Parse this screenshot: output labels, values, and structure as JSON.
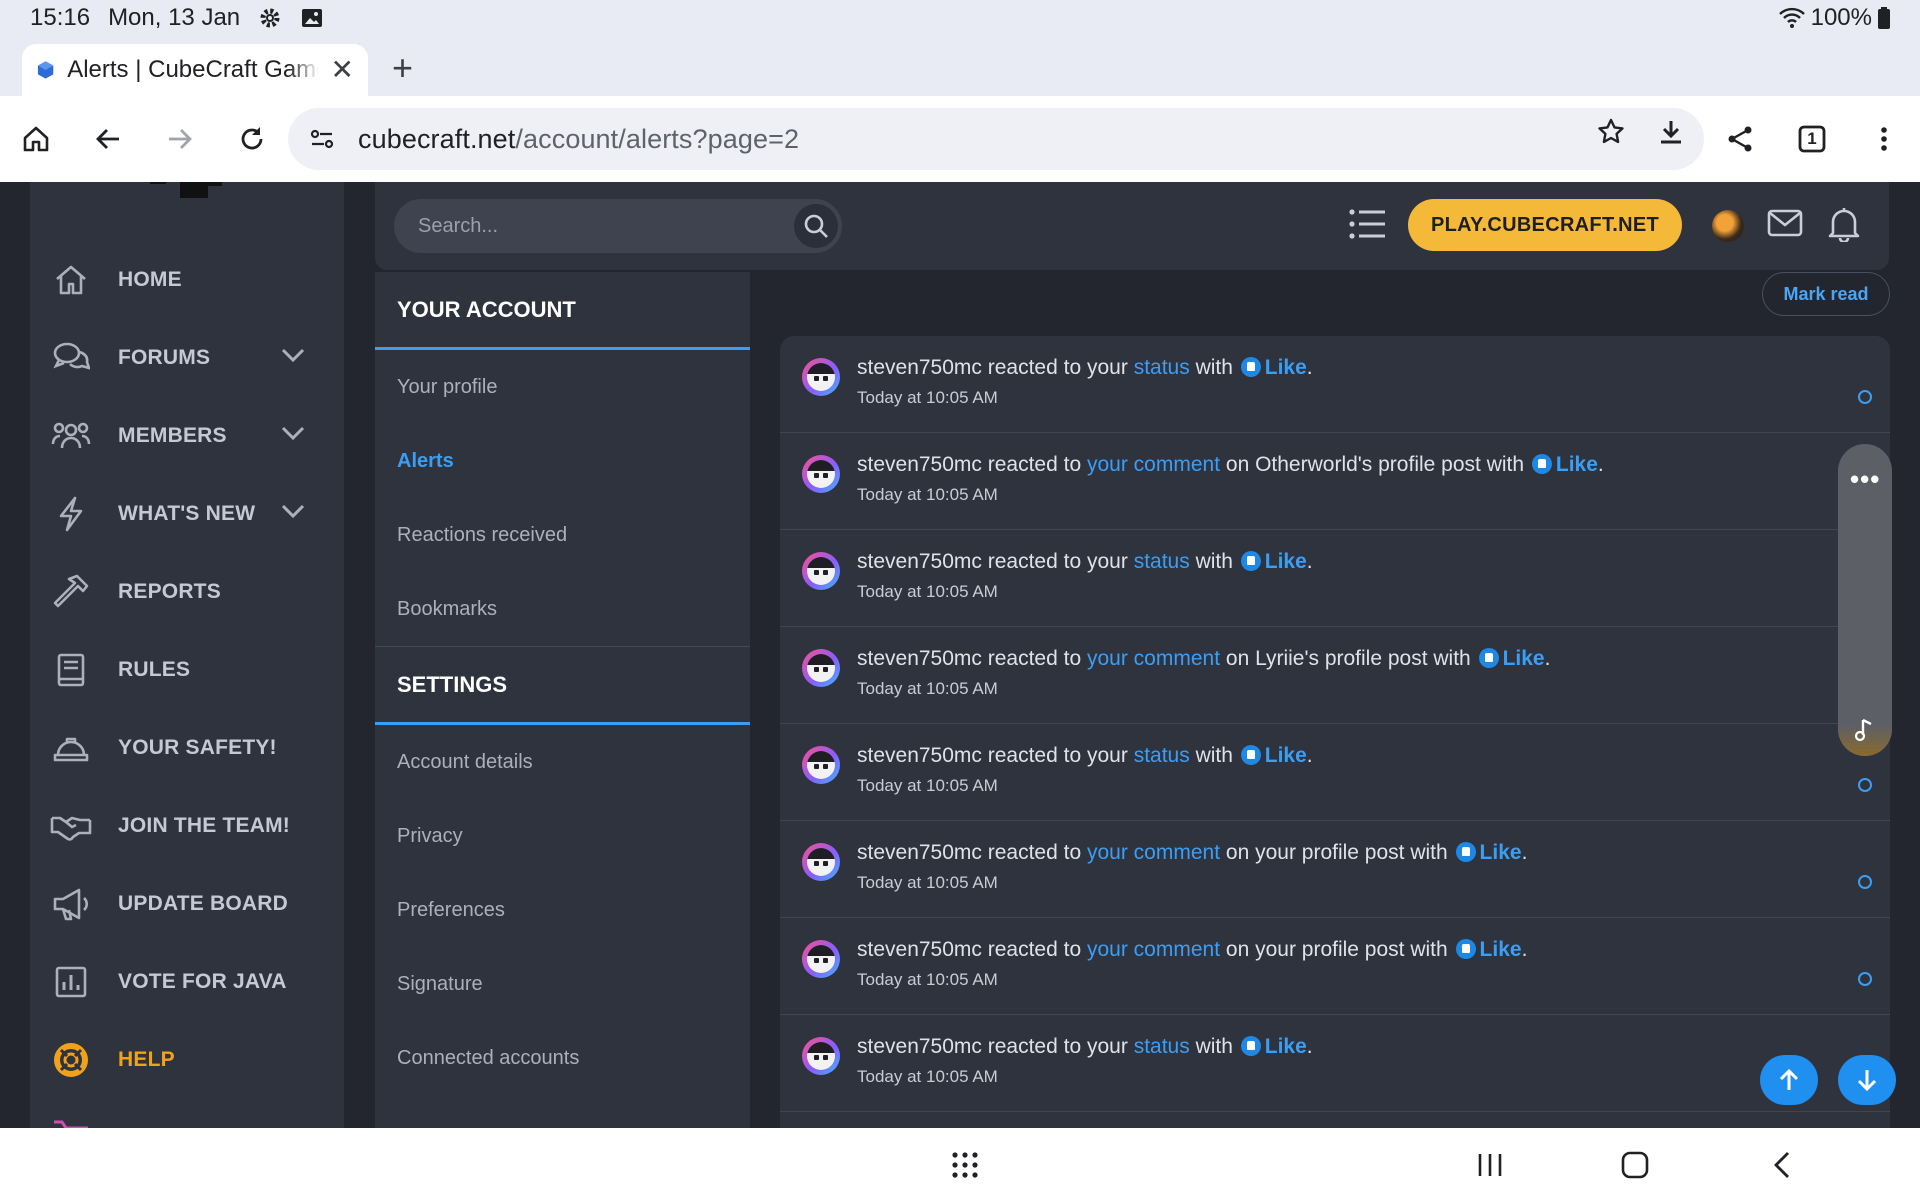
{
  "status_bar": {
    "time": "15:16",
    "date": "Mon, 13 Jan",
    "battery": "100%"
  },
  "browser": {
    "tab_title": "Alerts | CubeCraft Games",
    "url_host": "cubecraft.net",
    "url_path": "/account/alerts?page=2",
    "tab_count": "1"
  },
  "sidebar": {
    "items": [
      {
        "label": "HOME",
        "icon": "home-icon"
      },
      {
        "label": "FORUMS",
        "icon": "chat-icon"
      },
      {
        "label": "MEMBERS",
        "icon": "users-icon"
      },
      {
        "label": "WHAT'S NEW",
        "icon": "bolt-icon"
      },
      {
        "label": "REPORTS",
        "icon": "hammer-icon"
      },
      {
        "label": "RULES",
        "icon": "book-icon"
      },
      {
        "label": "YOUR SAFETY!",
        "icon": "helmet-icon"
      },
      {
        "label": "JOIN THE TEAM!",
        "icon": "handshake-icon"
      },
      {
        "label": "UPDATE BOARD",
        "icon": "megaphone-icon"
      },
      {
        "label": "VOTE FOR JAVA",
        "icon": "chart-icon"
      },
      {
        "label": "HELP",
        "icon": "lifebuoy-icon"
      }
    ]
  },
  "topbar": {
    "search_placeholder": "Search...",
    "play_button": "PLAY.CUBECRAFT.NET"
  },
  "account_menu": {
    "your_account_heading": "YOUR ACCOUNT",
    "your_account_items": [
      "Your profile",
      "Alerts",
      "Reactions received",
      "Bookmarks"
    ],
    "settings_heading": "SETTINGS",
    "settings_items": [
      "Account details",
      "Privacy",
      "Preferences",
      "Signature",
      "Connected accounts"
    ]
  },
  "mark_read": "Mark read",
  "alerts": [
    {
      "user": "steven750mc",
      "pre": "reacted to your",
      "link": "status",
      "post": "with",
      "reaction": "Like",
      "time": "Today at 10:05 AM"
    },
    {
      "user": "steven750mc",
      "pre": "reacted to",
      "link": "your comment",
      "post": "on Otherworld's profile post with",
      "reaction": "Like",
      "time": "Today at 10:05 AM"
    },
    {
      "user": "steven750mc",
      "pre": "reacted to your",
      "link": "status",
      "post": "with",
      "reaction": "Like",
      "time": "Today at 10:05 AM"
    },
    {
      "user": "steven750mc",
      "pre": "reacted to",
      "link": "your comment",
      "post": "on Lyriie's profile post with",
      "reaction": "Like",
      "time": "Today at 10:05 AM"
    },
    {
      "user": "steven750mc",
      "pre": "reacted to your",
      "link": "status",
      "post": "with",
      "reaction": "Like",
      "time": "Today at 10:05 AM"
    },
    {
      "user": "steven750mc",
      "pre": "reacted to",
      "link": "your comment",
      "post": "on your profile post with",
      "reaction": "Like",
      "time": "Today at 10:05 AM"
    },
    {
      "user": "steven750mc",
      "pre": "reacted to",
      "link": "your comment",
      "post": "on your profile post with",
      "reaction": "Like",
      "time": "Today at 10:05 AM"
    },
    {
      "user": "steven750mc",
      "pre": "reacted to your",
      "link": "status",
      "post": "with",
      "reaction": "Like",
      "time": "Today at 10:05 AM"
    }
  ],
  "colors": {
    "accent": "#3b9ef5",
    "play_button": "#f5b93a",
    "help": "#f0a21b",
    "page_bg": "#23262f",
    "panel_bg": "#2f333e"
  }
}
